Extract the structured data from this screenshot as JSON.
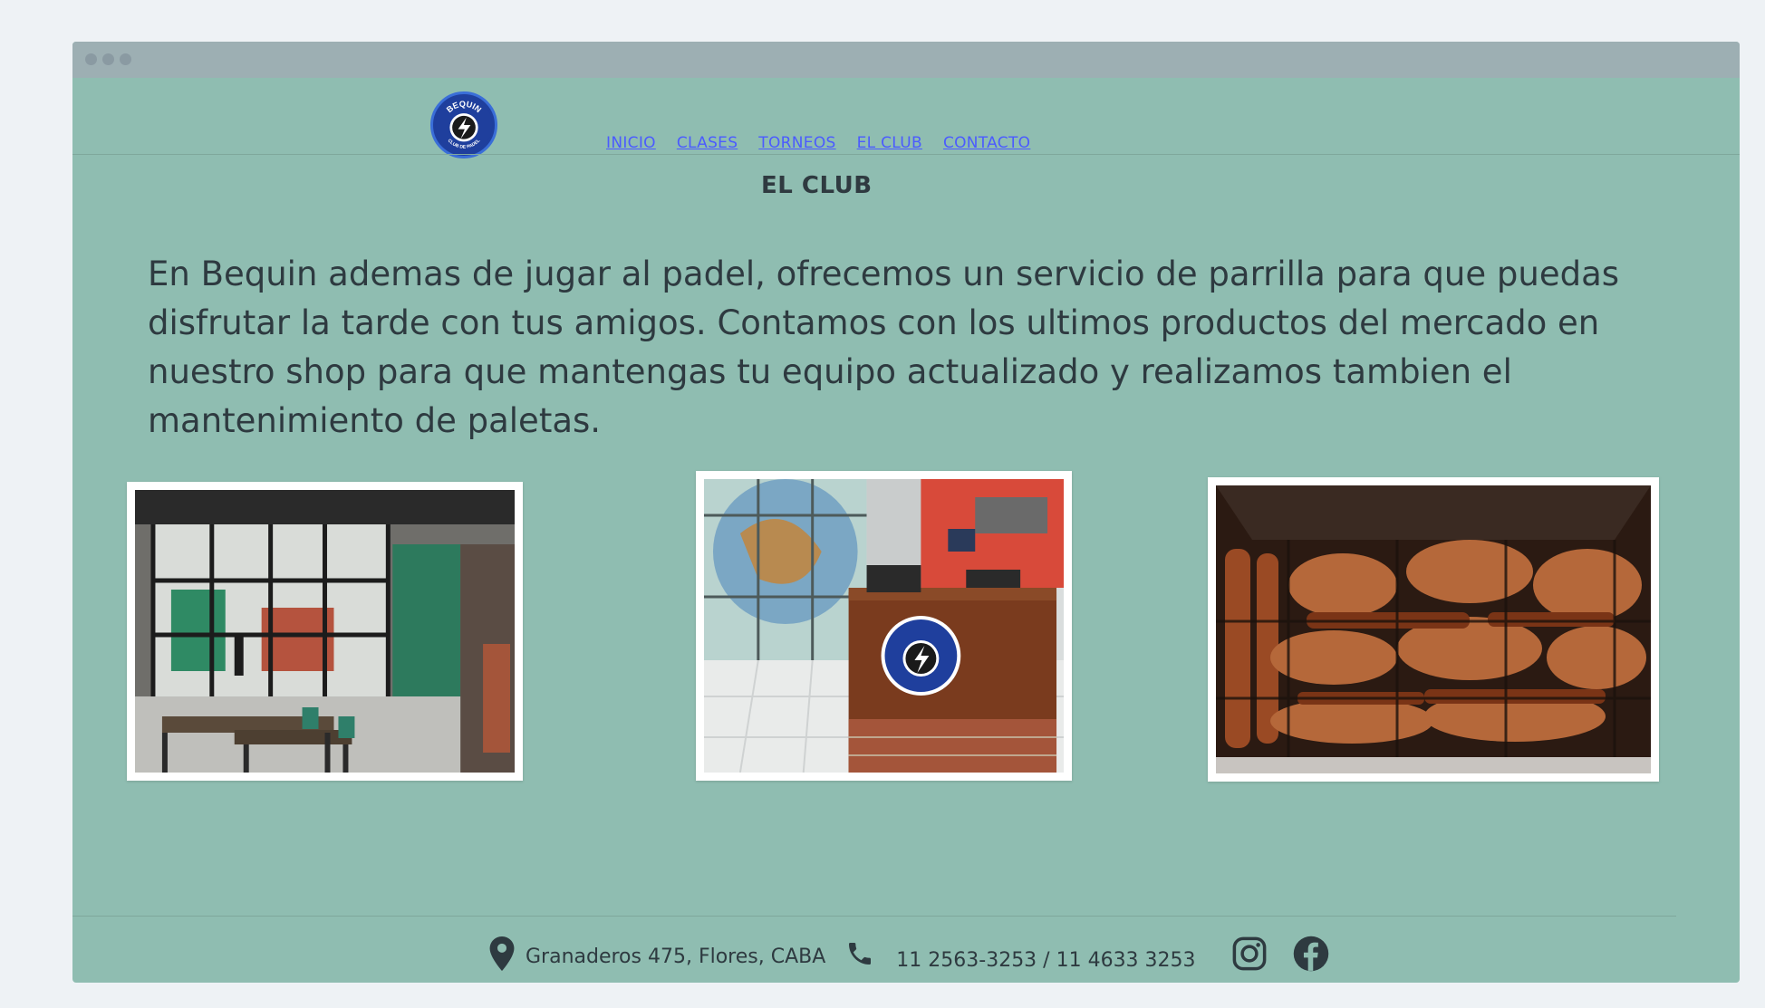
{
  "brand": {
    "logo_text_top": "BEQUIN",
    "logo_text_bottom": "CLUB DE PADEL",
    "colors": {
      "primary": "#1f3f9d",
      "accent": "#3a6ed8",
      "page_bg": "#8fbdb1"
    }
  },
  "nav": {
    "items": [
      {
        "label": "INICIO"
      },
      {
        "label": "CLASES"
      },
      {
        "label": "TORNEOS"
      },
      {
        "label": "EL CLUB"
      },
      {
        "label": "CONTACTO"
      }
    ]
  },
  "main": {
    "title": "EL CLUB",
    "intro": "En Bequin ademas de jugar al padel, ofrecemos un servicio de parrilla para que puedas disfrutar la tarde con tus amigos. Contamos con los ultimos productos del mercado en nuestro shop para que mantengas tu equipo actualizado y realizamos tambien el mantenimiento de paletas.",
    "photos": [
      {
        "icon": "club-interior-photo"
      },
      {
        "icon": "shop-counter-photo"
      },
      {
        "icon": "parrilla-grill-photo"
      }
    ]
  },
  "footer": {
    "address": "Granaderos 475, Flores, CABA",
    "phones": "11 2563-3253 / 11 4633 3253",
    "icons": [
      "location-pin-icon",
      "phone-icon",
      "instagram-icon",
      "facebook-icon"
    ]
  }
}
